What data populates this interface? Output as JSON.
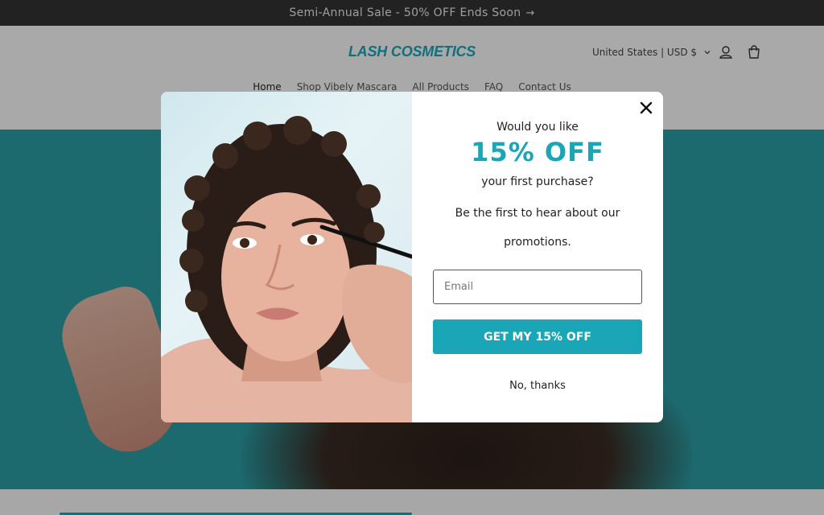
{
  "announcement": {
    "text": "Semi-Annual Sale - 50% OFF Ends Soon",
    "arrow": "→"
  },
  "header": {
    "logo": "LASH COSMETICS",
    "locale": "United States | USD $",
    "nav": [
      "Home",
      "Shop Vibely Mascara",
      "All Products",
      "FAQ",
      "Contact Us"
    ],
    "icons": {
      "account": "account-icon",
      "cart": "cart-icon",
      "locale_caret": "chevron-down-icon"
    }
  },
  "popup": {
    "line1": "Would you like",
    "headline": "15% OFF",
    "line2": "your first purchase?",
    "line3": "Be the first to hear about our promotions.",
    "email_placeholder": "Email",
    "cta": "GET MY 15% OFF",
    "dismiss": "No, thanks",
    "close_icon": "close-icon"
  },
  "colors": {
    "accent": "#1aa6b7",
    "hero_bg": "#2a9ba2",
    "announce_bg": "#333333"
  }
}
